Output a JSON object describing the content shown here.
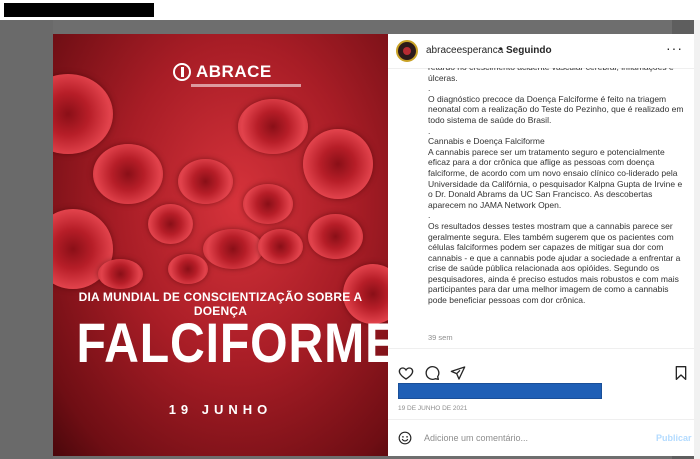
{
  "post": {
    "image": {
      "logo_text": "ABRACE",
      "headline_small": "DIA MUNDIAL DE CONSCIENTIZAÇÃO SOBRE A DOENÇA",
      "headline_big": "FALCIFORME",
      "date": "19 JUNHO"
    },
    "header": {
      "username": "abraceesperanca",
      "separator": "•",
      "follow_status": "Seguindo",
      "more_icon": "ellipsis-icon"
    },
    "caption": [
      "retardo no crescimento acidente vascular cerebral, inflamações e úlceras.",
      ".",
      "O diagnóstico precoce da Doença Falciforme é feito na triagem neonatal com a realização do Teste do Pezinho, que é realizado em todo sistema de saúde do Brasil.",
      ".",
      "Cannabis e Doença Falciforme",
      "A cannabis parece ser um tratamento seguro e potencialmente eficaz para a dor crônica que aflige as pessoas com doença falciforme, de acordo com um novo ensaio clínico co-liderado pela Universidade da Califórnia, o pesquisador Kalpna Gupta de Irvine e o Dr. Donald Abrams da UC San Francisco. As descobertas aparecem no JAMA Network Open.",
      ".",
      "Os resultados desses testes mostram que a cannabis parece ser geralmente segura. Eles também sugerem que os pacientes com células falciformes podem ser capazes de mitigar sua dor com cannabis - e que a cannabis pode ajudar a sociedade a enfrentar a crise de saúde pública relacionada aos opióides. Segundo os pesquisadores, ainda é preciso estudos mais robustos e com mais participantes para dar uma melhor imagem de como a cannabis pode beneficiar pessoas com dor crônica."
    ],
    "time_ago": "39 sem",
    "actions": {
      "like_icon": "heart-icon",
      "comment_icon": "comment-icon",
      "share_icon": "paper-plane-icon",
      "save_icon": "bookmark-icon"
    },
    "post_date": "19 DE JUNHO DE 2021",
    "comment": {
      "placeholder": "Adicione um comentário...",
      "publish_label": "Publicar",
      "emoji_icon": "smiley-icon"
    }
  },
  "colors": {
    "publish_disabled": "#b3dbff",
    "likes_redaction": "#1f5fb6",
    "story_ring": "#c9a227"
  }
}
